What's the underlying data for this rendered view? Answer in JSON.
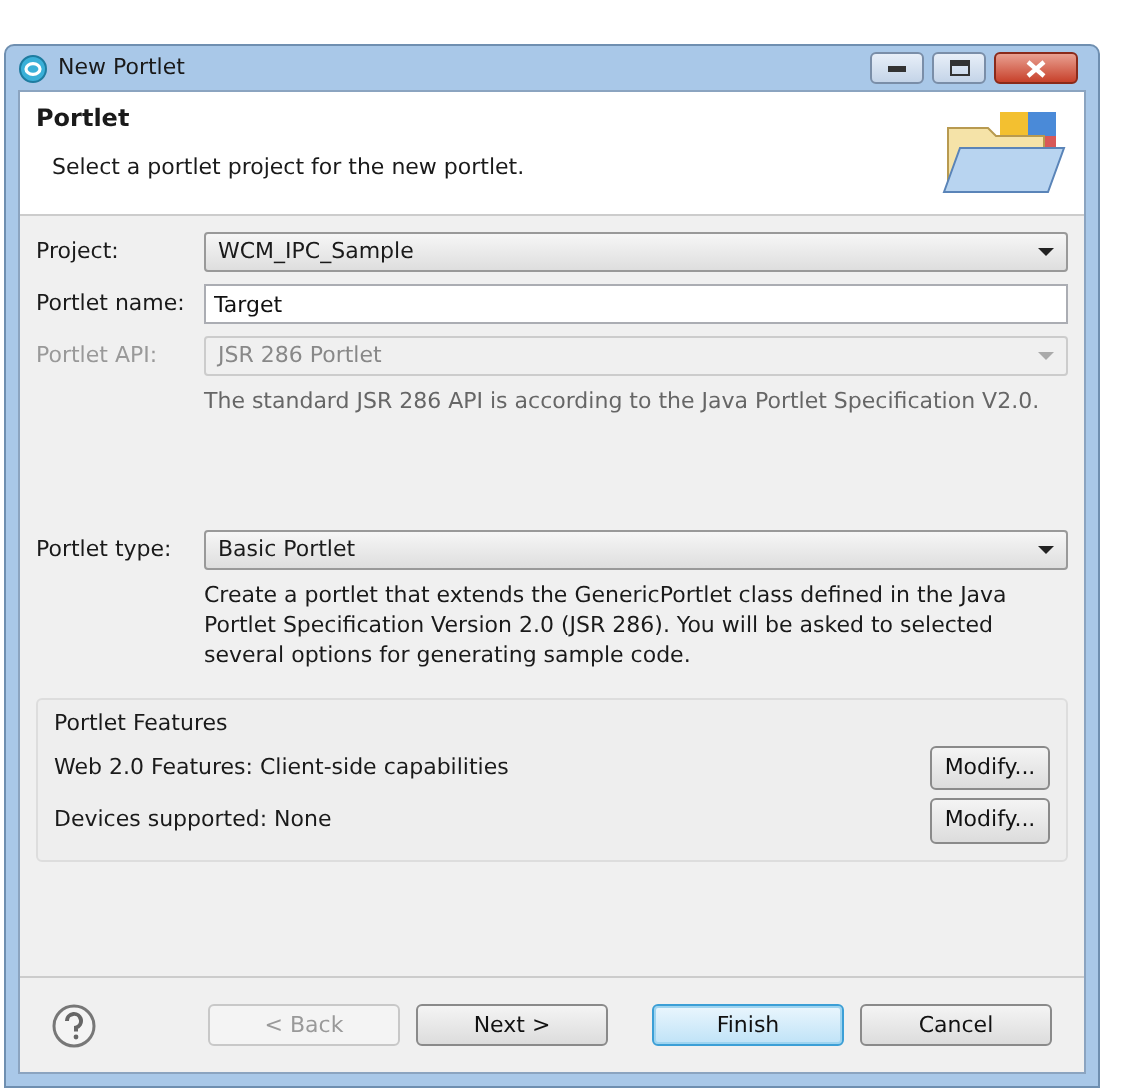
{
  "window": {
    "title": "New Portlet"
  },
  "header": {
    "title": "Portlet",
    "description": "Select a portlet project for the new portlet."
  },
  "fields": [
    {
      "kind": "select",
      "label": "Project:",
      "value": "WCM_IPC_Sample",
      "disabled": false
    },
    {
      "kind": "text",
      "label": "Portlet name:",
      "value": "Target",
      "disabled": false
    },
    {
      "kind": "select",
      "label": "Portlet API:",
      "value": "JSR 286 Portlet",
      "disabled": true,
      "note": "The standard JSR 286 API is according to the Java Portlet Specification V2.0."
    },
    {
      "kind": "select",
      "label": "Portlet type:",
      "value": "Basic Portlet",
      "disabled": false,
      "note": "Create a portlet that extends the GenericPortlet class defined in the Java Portlet Specification Version 2.0 (JSR 286).  You will be asked to selected several options for generating sample code."
    }
  ],
  "features": {
    "title": "Portlet Features",
    "rows": [
      {
        "label": "Web 2.0 Features: Client-side capabilities",
        "button": "Modify..."
      },
      {
        "label": "Devices supported:  None",
        "button": "Modify..."
      }
    ]
  },
  "buttons": [
    {
      "label": "< Back",
      "disabled": true,
      "default": false
    },
    {
      "label": "Next >",
      "disabled": false,
      "default": false
    },
    {
      "label": "Finish",
      "disabled": false,
      "default": true
    },
    {
      "label": "Cancel",
      "disabled": false,
      "default": false
    }
  ]
}
